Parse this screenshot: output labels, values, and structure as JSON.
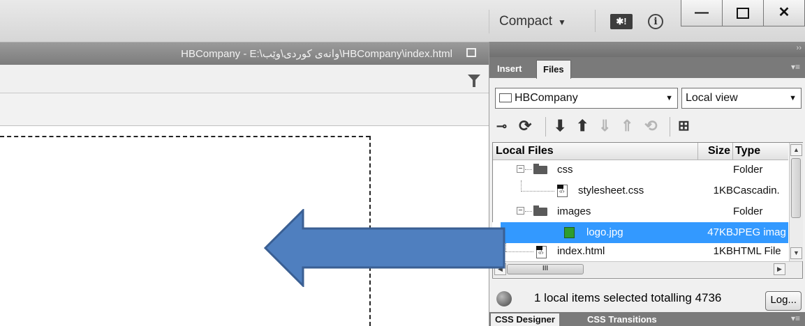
{
  "topbar": {
    "workspace_label": "Compact",
    "site_icon_text": "✱!",
    "info_icon_text": "i",
    "window_buttons": {
      "minimize": "—",
      "restore": "🗗",
      "close": "✕"
    }
  },
  "document": {
    "title": "HBCompany - E:\\وانەی کوردی\\وێب\\HBCompany\\index.html"
  },
  "panel": {
    "tabs": [
      "Insert",
      "Files"
    ],
    "active_tab": "Files",
    "site_select": "HBCompany",
    "view_select": "Local view",
    "columns": {
      "name": "Local Files",
      "size": "Size",
      "type": "Type"
    },
    "files": [
      {
        "name": "css",
        "size": "",
        "type": "Folder",
        "kind": "folder"
      },
      {
        "name": "stylesheet.css",
        "size": "1KB",
        "type": "Cascadin.",
        "kind": "code"
      },
      {
        "name": "images",
        "size": "",
        "type": "Folder",
        "kind": "folder"
      },
      {
        "name": "logo.jpg",
        "size": "47KB",
        "type": "JPEG imag",
        "kind": "image",
        "selected": true
      },
      {
        "name": "index.html",
        "size": "1KB",
        "type": "HTML File",
        "kind": "code"
      }
    ],
    "hscroll_grip": "III",
    "status_text": "1 local items selected totalling 4736",
    "log_button": "Log...",
    "bottom_tabs": [
      "CSS Designer",
      "CSS Transitions"
    ]
  },
  "colors": {
    "selection": "#3399ff",
    "arrow_fill": "#4f7fbf",
    "arrow_stroke": "#3a5f93"
  }
}
